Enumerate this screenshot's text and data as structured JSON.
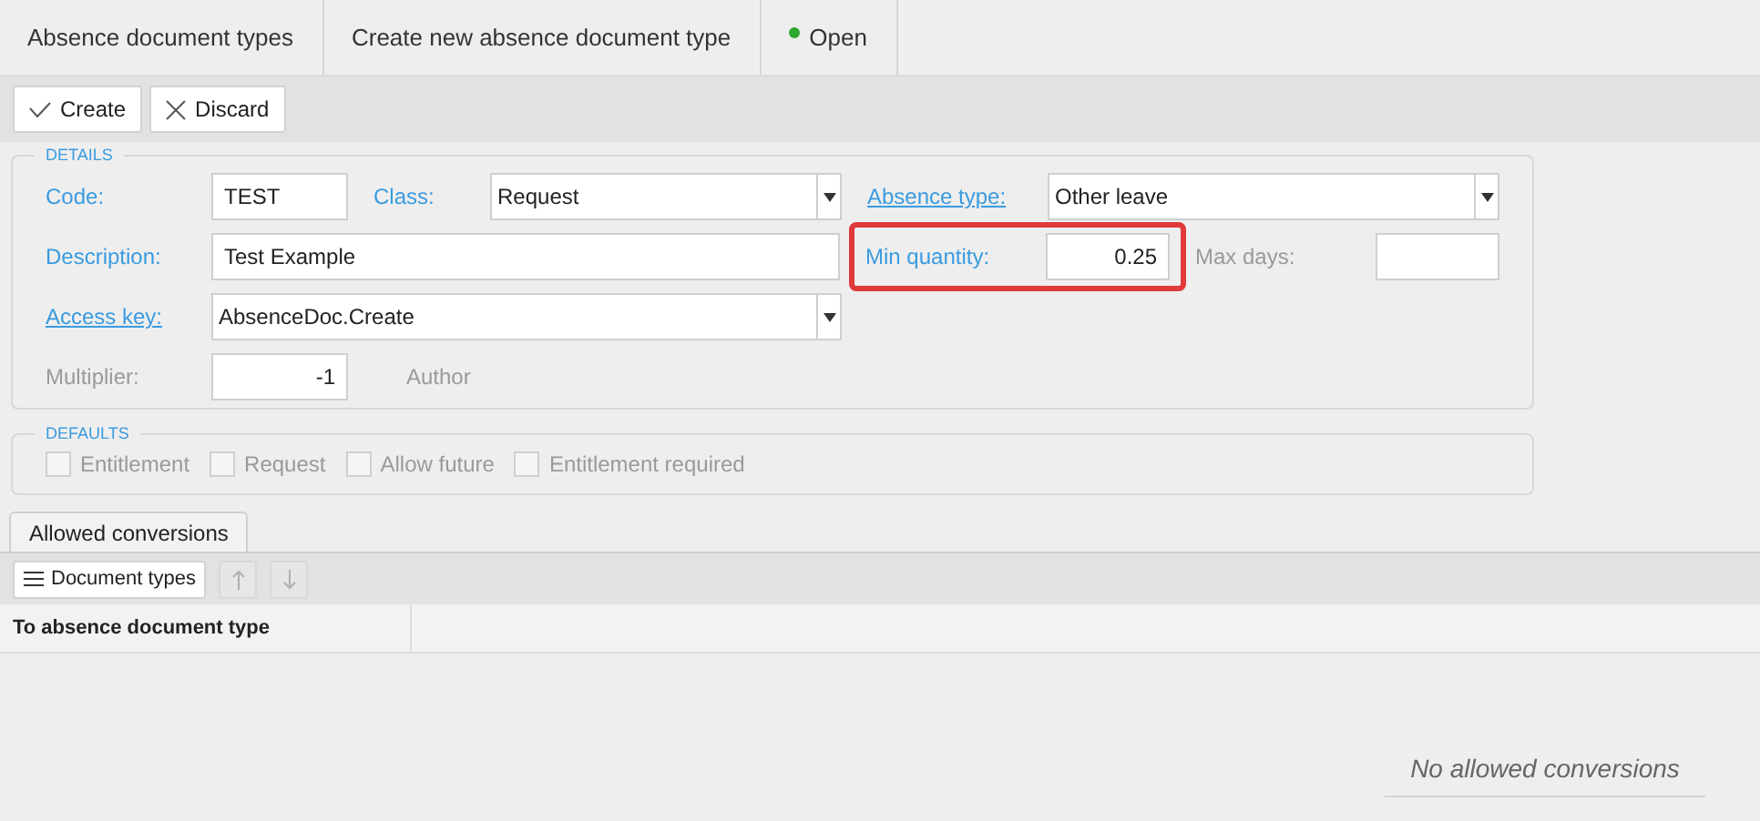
{
  "breadcrumb": [
    {
      "label": "Absence document types",
      "dot": false
    },
    {
      "label": "Create new absence document type",
      "dot": false
    },
    {
      "label": "Open",
      "dot": true
    }
  ],
  "toolbar": [
    {
      "label": "Create"
    },
    {
      "label": "Discard"
    }
  ],
  "details": {
    "legend": "DETAILS",
    "code": {
      "label": "Code:",
      "value": "TEST"
    },
    "class": {
      "label": "Class:",
      "value": "Request"
    },
    "absence_type": {
      "label": "Absence type:",
      "link": true,
      "value": "Other leave"
    },
    "description": {
      "label": "Description:",
      "value": "Test Example"
    },
    "min_quantity": {
      "label": "Min quantity:",
      "value": "0.25",
      "highlighted": true
    },
    "max_days": {
      "label": "Max days:",
      "disabled": true
    },
    "access_key": {
      "label": "Access key:",
      "link": true,
      "value": "AbsenceDoc.Create"
    },
    "multiplier": {
      "label": "Multiplier:",
      "disabled": true,
      "value": "-1"
    },
    "author": {
      "label": "Author",
      "disabled": true
    }
  },
  "defaults": {
    "legend": "DEFAULTS",
    "items": [
      {
        "label": "Entitlement",
        "checked": false,
        "disabled": true
      },
      {
        "label": "Request",
        "checked": false,
        "disabled": true
      },
      {
        "label": "Allow future",
        "checked": false,
        "disabled": true
      },
      {
        "label": "Entitlement required",
        "checked": false,
        "disabled": true
      }
    ]
  },
  "tabs": [
    {
      "label": "Allowed conversions",
      "selected": true
    }
  ],
  "grid_toolbar": {
    "button": "Document types",
    "move_up_disabled": true,
    "move_down_disabled": true
  },
  "table": {
    "columns": [
      "To absence document type"
    ],
    "empty_message": "No allowed conversions"
  }
}
